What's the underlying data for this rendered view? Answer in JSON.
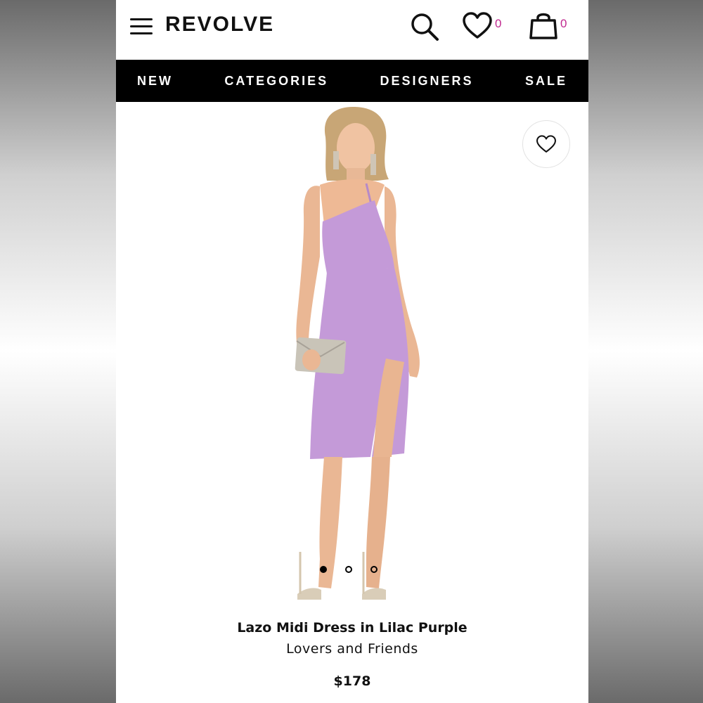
{
  "header": {
    "logo": "REVOLVE",
    "wishlist_count": "0",
    "bag_count": "0",
    "count_color": "#c0298f"
  },
  "nav": {
    "items": [
      "NEW",
      "CATEGORIES",
      "DESIGNERS",
      "SALE"
    ]
  },
  "gallery": {
    "total_images": 3,
    "active_index": 0
  },
  "product": {
    "name": "Lazo Midi Dress in Lilac Purple",
    "brand": "Lovers and Friends",
    "price": "$178",
    "dress_color": "#c49ad8"
  },
  "icons": [
    "menu-icon",
    "search-icon",
    "heart-icon",
    "bag-icon",
    "favorite-heart-icon"
  ]
}
